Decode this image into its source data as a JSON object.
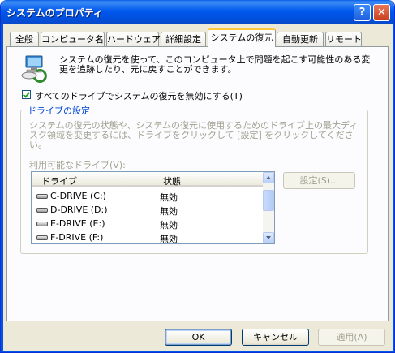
{
  "window": {
    "title": "システムのプロパティ",
    "help_button": "?",
    "close_button": "✕"
  },
  "tabs": [
    {
      "label": "全般"
    },
    {
      "label": "コンピュータ名"
    },
    {
      "label": "ハードウェア"
    },
    {
      "label": "詳細設定"
    },
    {
      "label": "システムの復元"
    },
    {
      "label": "自動更新"
    },
    {
      "label": "リモート"
    }
  ],
  "active_tab": "システムの復元",
  "description": "システムの復元を使って、このコンピュータ上で問題を起こす可能性のある変更を追跡したり、元に戻すことができます。",
  "disable_checkbox": {
    "label": "すべてのドライブでシステムの復元を無効にする(T)",
    "checked": true
  },
  "drive_settings": {
    "title": "ドライブの設定",
    "description": "システムの復元の状態や、システムの復元に使用するためのドライブ上の最大ディスク領域を変更するには、ドライブをクリックして [設定] をクリックしてください。",
    "available_label": "利用可能なドライブ(V):",
    "columns": [
      "ドライブ",
      "状態"
    ],
    "drives": [
      {
        "name": "C-DRIVE (C:)",
        "status": "無効"
      },
      {
        "name": "D-DRIVE (D:)",
        "status": "無効"
      },
      {
        "name": "E-DRIVE (E:)",
        "status": "無効"
      },
      {
        "name": "F-DRIVE (F:)",
        "status": "無効"
      }
    ],
    "settings_button": "設定(S)..."
  },
  "buttons": {
    "ok": "OK",
    "cancel": "キャンセル",
    "apply": "適用(A)"
  },
  "colors": {
    "title_bar": "#0058ee",
    "group_title": "#0046d5",
    "active_tab_highlight": "#ffc83c",
    "dialog_bg": "#ece9d8"
  }
}
